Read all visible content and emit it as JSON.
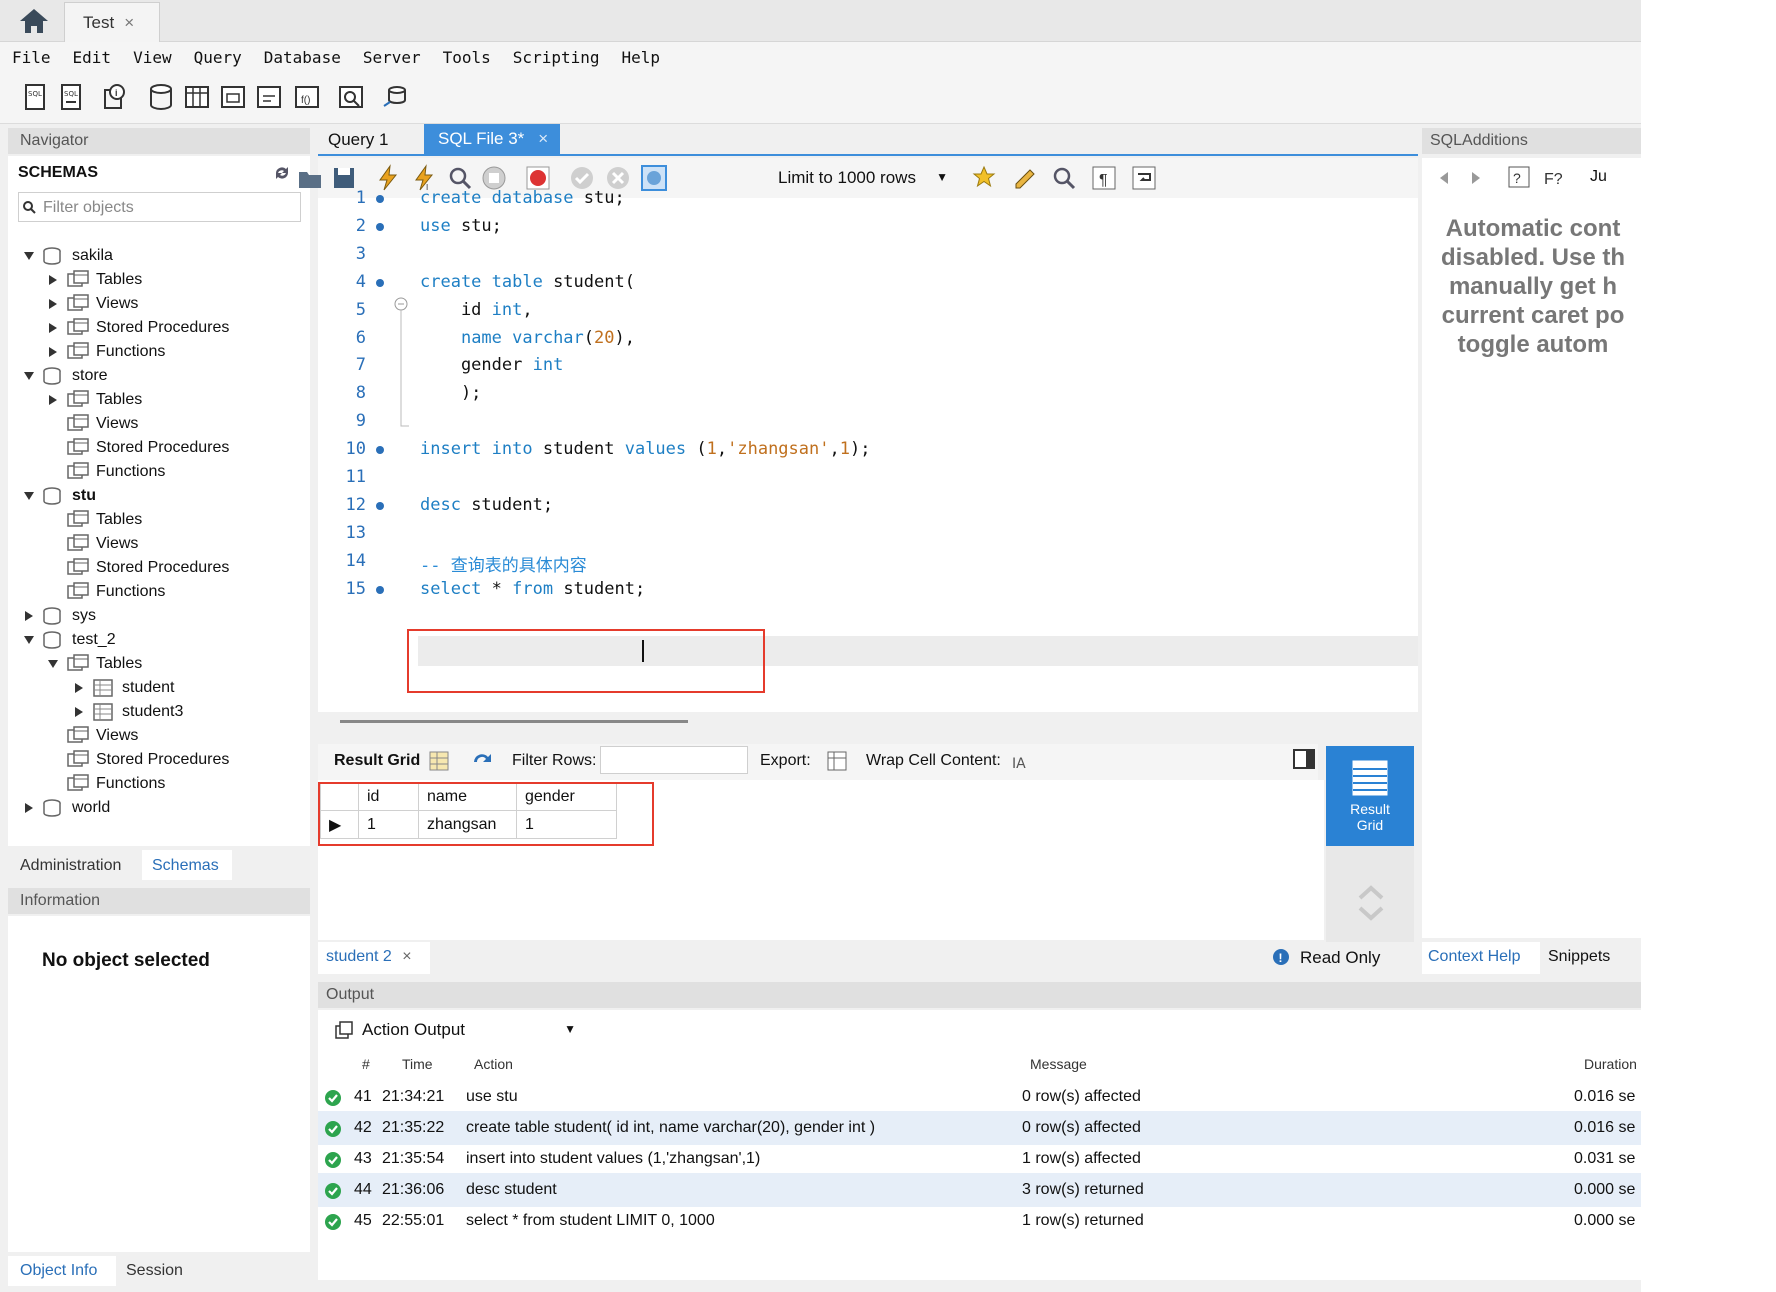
{
  "window": {
    "connection_tab": "Test",
    "close_glyph": "×"
  },
  "menu": [
    "File",
    "Edit",
    "View",
    "Query",
    "Database",
    "Server",
    "Tools",
    "Scripting",
    "Help"
  ],
  "navigator": {
    "title": "Navigator",
    "schemas_label": "SCHEMAS",
    "filter_placeholder": "Filter objects",
    "tree": [
      {
        "label": "sakila",
        "level": 0,
        "open": true,
        "kind": "db",
        "bold": false
      },
      {
        "label": "Tables",
        "level": 1,
        "open": false,
        "kind": "folder"
      },
      {
        "label": "Views",
        "level": 1,
        "open": false,
        "kind": "folder"
      },
      {
        "label": "Stored Procedures",
        "level": 1,
        "open": false,
        "kind": "folder"
      },
      {
        "label": "Functions",
        "level": 1,
        "open": false,
        "kind": "folder"
      },
      {
        "label": "store",
        "level": 0,
        "open": true,
        "kind": "db",
        "bold": false
      },
      {
        "label": "Tables",
        "level": 1,
        "open": false,
        "kind": "folder"
      },
      {
        "label": "Views",
        "level": 1,
        "open": null,
        "kind": "folder"
      },
      {
        "label": "Stored Procedures",
        "level": 1,
        "open": null,
        "kind": "folder"
      },
      {
        "label": "Functions",
        "level": 1,
        "open": null,
        "kind": "folder"
      },
      {
        "label": "stu",
        "level": 0,
        "open": true,
        "kind": "db",
        "bold": true
      },
      {
        "label": "Tables",
        "level": 1,
        "open": null,
        "kind": "folder"
      },
      {
        "label": "Views",
        "level": 1,
        "open": null,
        "kind": "folder"
      },
      {
        "label": "Stored Procedures",
        "level": 1,
        "open": null,
        "kind": "folder"
      },
      {
        "label": "Functions",
        "level": 1,
        "open": null,
        "kind": "folder"
      },
      {
        "label": "sys",
        "level": 0,
        "open": false,
        "kind": "db",
        "bold": false
      },
      {
        "label": "test_2",
        "level": 0,
        "open": true,
        "kind": "db",
        "bold": false
      },
      {
        "label": "Tables",
        "level": 1,
        "open": true,
        "kind": "folder"
      },
      {
        "label": "student",
        "level": 2,
        "open": false,
        "kind": "table"
      },
      {
        "label": "student3",
        "level": 2,
        "open": false,
        "kind": "table"
      },
      {
        "label": "Views",
        "level": 1,
        "open": null,
        "kind": "folder"
      },
      {
        "label": "Stored Procedures",
        "level": 1,
        "open": null,
        "kind": "folder"
      },
      {
        "label": "Functions",
        "level": 1,
        "open": null,
        "kind": "folder"
      },
      {
        "label": "world",
        "level": 0,
        "open": false,
        "kind": "db",
        "bold": false
      }
    ],
    "tabs": {
      "admin": "Administration",
      "schemas": "Schemas"
    },
    "info_title": "Information",
    "no_object": "No object selected",
    "bottom_tabs": {
      "object_info": "Object Info",
      "session": "Session"
    }
  },
  "editor": {
    "tabs": {
      "query1": "Query 1",
      "sql_file": "SQL File 3*"
    },
    "limit_label": "Limit to 1000 rows",
    "lines": [
      {
        "n": "1",
        "dot": true,
        "tokens": [
          [
            "kw",
            "create database "
          ],
          [
            "",
            "stu;"
          ]
        ]
      },
      {
        "n": "2",
        "dot": true,
        "tokens": [
          [
            "kw",
            "use "
          ],
          [
            "",
            "stu;"
          ]
        ]
      },
      {
        "n": "3",
        "dot": false,
        "tokens": []
      },
      {
        "n": "4",
        "dot": true,
        "tokens": [
          [
            "kw",
            "create table "
          ],
          [
            "",
            "student("
          ]
        ]
      },
      {
        "n": "5",
        "dot": false,
        "tokens": [
          [
            "",
            "    id "
          ],
          [
            "kw",
            "int"
          ],
          [
            "",
            ","
          ]
        ]
      },
      {
        "n": "6",
        "dot": false,
        "tokens": [
          [
            "",
            "    "
          ],
          [
            "kw",
            "name varchar"
          ],
          [
            "",
            "("
          ],
          [
            "str",
            "20"
          ],
          [
            "",
            "),"
          ]
        ]
      },
      {
        "n": "7",
        "dot": false,
        "tokens": [
          [
            "",
            "    gender "
          ],
          [
            "kw",
            "int"
          ]
        ]
      },
      {
        "n": "8",
        "dot": false,
        "tokens": [
          [
            "",
            "    );"
          ]
        ]
      },
      {
        "n": "9",
        "dot": false,
        "tokens": []
      },
      {
        "n": "10",
        "dot": true,
        "tokens": [
          [
            "kw",
            "insert into "
          ],
          [
            "",
            "student "
          ],
          [
            "kw",
            "values "
          ],
          [
            "",
            "("
          ],
          [
            "str",
            "1"
          ],
          [
            "",
            ","
          ],
          [
            "str",
            "'zhangsan'"
          ],
          [
            "",
            ","
          ],
          [
            "str",
            "1"
          ],
          [
            "",
            ");"
          ]
        ]
      },
      {
        "n": "11",
        "dot": false,
        "tokens": []
      },
      {
        "n": "12",
        "dot": true,
        "tokens": [
          [
            "kw",
            "desc "
          ],
          [
            "",
            "student;"
          ]
        ]
      },
      {
        "n": "13",
        "dot": false,
        "tokens": []
      },
      {
        "n": "14",
        "dot": false,
        "tokens": [
          [
            "cm",
            "-- 查询表的具体内容"
          ]
        ]
      },
      {
        "n": "15",
        "dot": true,
        "tokens": [
          [
            "kw",
            "select "
          ],
          [
            "",
            "* "
          ],
          [
            "kw",
            "from "
          ],
          [
            "",
            "student;"
          ]
        ]
      }
    ]
  },
  "result": {
    "grid_label": "Result Grid",
    "filter_rows": "Filter Rows:",
    "export": "Export:",
    "wrap": "Wrap Cell Content:",
    "columns": [
      "id",
      "name",
      "gender"
    ],
    "rows": [
      [
        "1",
        "zhangsan",
        "1"
      ]
    ],
    "side_label_1": "Result",
    "side_label_2": "Grid",
    "tab": "student 2",
    "read_only": "Read Only"
  },
  "sql_additions": {
    "title": "SQLAdditions",
    "jump": "Ju",
    "lines": [
      "Automatic cont",
      "disabled. Use th",
      "manually get h",
      "current caret po",
      "toggle autom"
    ],
    "tabs": {
      "context": "Context Help",
      "snippets": "Snippets"
    }
  },
  "output": {
    "title": "Output",
    "mode": "Action Output",
    "headers": [
      "#",
      "Time",
      "Action",
      "Message",
      "Duration"
    ],
    "rows": [
      {
        "n": "41",
        "time": "21:34:21",
        "action": "use stu",
        "msg": "0 row(s) affected",
        "dur": "0.016 se"
      },
      {
        "n": "42",
        "time": "21:35:22",
        "action": "create table student( id int,    name varchar(20),    gender int    )",
        "msg": "0 row(s) affected",
        "dur": "0.016 se"
      },
      {
        "n": "43",
        "time": "21:35:54",
        "action": "insert into student values (1,'zhangsan',1)",
        "msg": "1 row(s) affected",
        "dur": "0.031 se"
      },
      {
        "n": "44",
        "time": "21:36:06",
        "action": "desc student",
        "msg": "3 row(s) returned",
        "dur": "0.000 se"
      },
      {
        "n": "45",
        "time": "22:55:01",
        "action": "select * from student LIMIT 0, 1000",
        "msg": "1 row(s) returned",
        "dur": "0.000 se"
      }
    ]
  },
  "colors": {
    "accent": "#3d8edb",
    "keyword": "#1e7fc4",
    "string": "#c0701e",
    "highlight": "#e53b2c",
    "ok": "#2da44e"
  }
}
